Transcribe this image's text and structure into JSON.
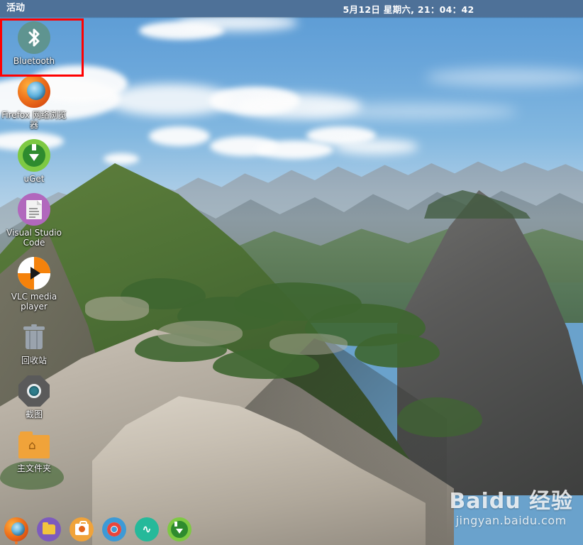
{
  "topbar": {
    "activities_label": "活动",
    "clock": "5月12日 星期六, 21：04：42"
  },
  "desktop_icons": [
    {
      "label": "Bluetooth",
      "icon": "bluetooth-icon",
      "selected": true
    },
    {
      "label": "Firefox 网络浏览器",
      "icon": "firefox-icon",
      "selected": false
    },
    {
      "label": "uGet",
      "icon": "uget-icon",
      "selected": false
    },
    {
      "label": "Visual Studio Code",
      "icon": "vscode-icon",
      "selected": false
    },
    {
      "label": "VLC media player",
      "icon": "vlc-icon",
      "selected": false
    },
    {
      "label": "回收站",
      "icon": "trash-icon",
      "selected": false
    },
    {
      "label": "截图",
      "icon": "screenshot-icon",
      "selected": false
    },
    {
      "label": "主文件夹",
      "icon": "home-folder-icon",
      "selected": false
    }
  ],
  "dock": {
    "items": [
      {
        "name": "firefox",
        "icon": "firefox-icon",
        "running": true
      },
      {
        "name": "files",
        "icon": "folder-icon",
        "running": false
      },
      {
        "name": "software",
        "icon": "ubuntu-software-icon",
        "running": false
      },
      {
        "name": "help",
        "icon": "lifebuoy-icon",
        "running": false
      },
      {
        "name": "system-monitor",
        "icon": "pulse-wave-icon",
        "running": false
      },
      {
        "name": "uget",
        "icon": "uget-icon",
        "running": false
      }
    ],
    "monitor_glyph": "∿"
  },
  "watermark": {
    "brand": "Baidu 经验",
    "url": "jingyan.baidu.com"
  },
  "colors": {
    "topbar_bg": "#4e7198",
    "selection_red": "#ff0000",
    "bluetooth_teal": "#5f9490",
    "uget_green": "#7ec943",
    "vscode_purple": "#b168bd",
    "home_orange": "#f0a33a"
  }
}
